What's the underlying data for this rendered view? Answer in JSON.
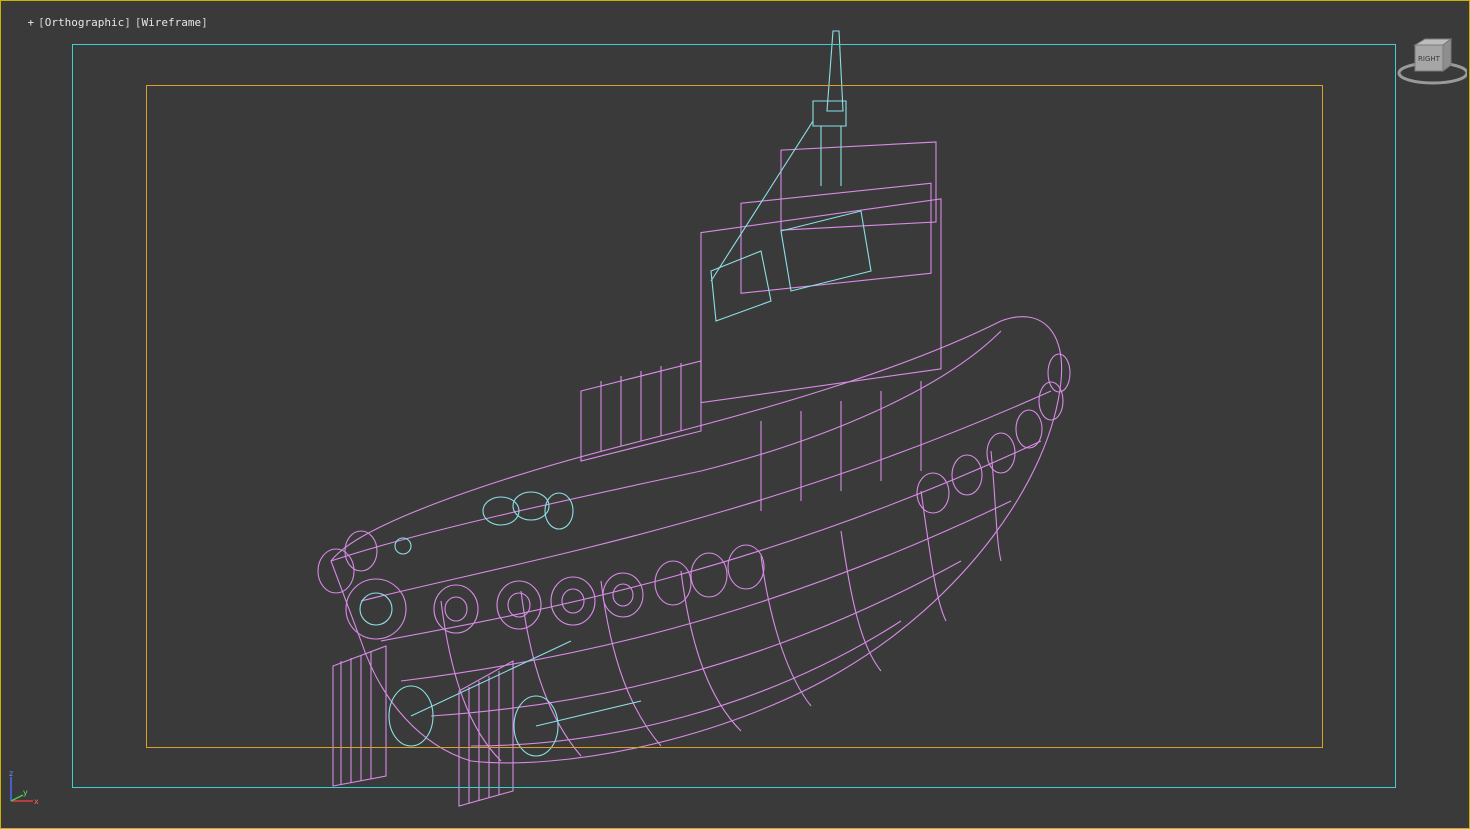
{
  "viewport": {
    "label": {
      "plus": "+",
      "view": "Orthographic",
      "shading": "Wireframe"
    },
    "viewcube_face_text": "RIGHT",
    "axes": {
      "x": "x",
      "y": "y",
      "z": "z"
    },
    "colors": {
      "background": "#3a3a3a",
      "active_border": "#c8b400",
      "safe_frame_outer": "#3ecfcf",
      "safe_frame_inner": "#d9a02a",
      "wire_primary": "#d88be6",
      "wire_secondary": "#8be0e6"
    }
  },
  "model": {
    "name_icon": "tugboat-wireframe-model"
  }
}
